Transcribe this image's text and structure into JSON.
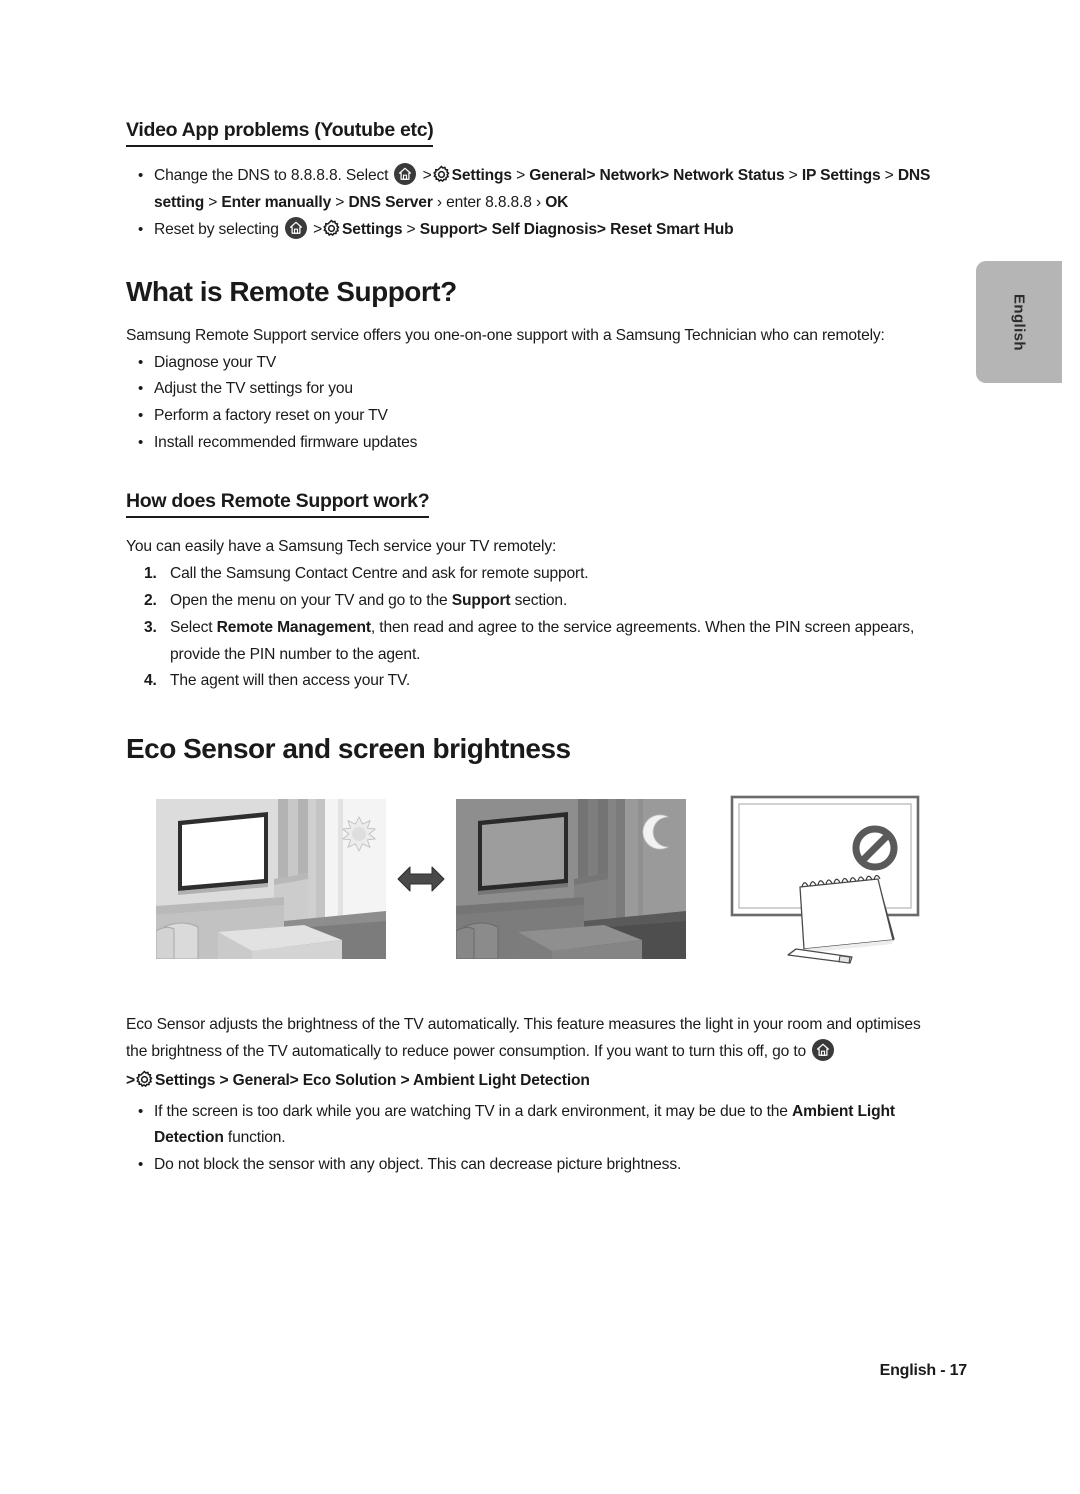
{
  "page": {
    "language_tab": "English",
    "footer": "English - 17"
  },
  "icons": {
    "home": "home-icon",
    "gear": "settings-gear-icon",
    "arrow": "double-arrow-icon",
    "prohibition": "prohibition-icon",
    "sun": "sun-icon",
    "moon": "moon-icon"
  },
  "sections": {
    "video_app": {
      "heading": "Video App problems (Youtube etc)",
      "bullets": [
        {
          "parts": [
            {
              "t": "Change the DNS to 8.8.8.8. Select ",
              "b": false
            },
            {
              "t": "HOME_ICON",
              "b": false
            },
            {
              "t": " >",
              "b": false
            },
            {
              "t": "GEAR_ICON",
              "b": false
            },
            {
              "t": "Settings",
              "b": true
            },
            {
              "t": " > ",
              "b": false
            },
            {
              "t": "General",
              "b": true
            },
            {
              "t": "> ",
              "b": true
            },
            {
              "t": "Network",
              "b": true
            },
            {
              "t": "> ",
              "b": true
            },
            {
              "t": "Network Status",
              "b": true
            },
            {
              "t": " > ",
              "b": false
            },
            {
              "t": "IP Settings",
              "b": true
            },
            {
              "t": " > ",
              "b": false
            },
            {
              "t": "DNS setting",
              "b": true
            },
            {
              "t": " > ",
              "b": false
            },
            {
              "t": "Enter manually",
              "b": true
            },
            {
              "t": " > ",
              "b": false
            },
            {
              "t": "DNS Server",
              "b": true
            },
            {
              "t": " › enter 8.8.8.8 › ",
              "b": false
            },
            {
              "t": "OK",
              "b": true
            }
          ]
        },
        {
          "parts": [
            {
              "t": "Reset by selecting ",
              "b": false
            },
            {
              "t": "HOME_ICON",
              "b": false
            },
            {
              "t": " >",
              "b": false
            },
            {
              "t": "GEAR_ICON",
              "b": false
            },
            {
              "t": "Settings",
              "b": true
            },
            {
              "t": " > ",
              "b": false
            },
            {
              "t": "Support",
              "b": true
            },
            {
              "t": "> ",
              "b": true
            },
            {
              "t": "Self Diagnosis",
              "b": true
            },
            {
              "t": "> ",
              "b": true
            },
            {
              "t": "Reset Smart Hub",
              "b": true
            }
          ]
        }
      ]
    },
    "remote_support": {
      "heading": "What is Remote Support?",
      "intro": "Samsung Remote Support service offers you one-on-one support with a Samsung Technician who can remotely:",
      "bullets": [
        "Diagnose your TV",
        "Adjust the TV settings for you",
        "Perform a factory reset on your TV",
        "Install recommended firmware updates"
      ]
    },
    "how_it_works": {
      "heading": "How does Remote Support work?",
      "intro": "You can easily have a Samsung Tech service your TV remotely:",
      "steps": [
        {
          "parts": [
            {
              "t": "Call the Samsung Contact Centre and ask for remote support.",
              "b": false
            }
          ]
        },
        {
          "parts": [
            {
              "t": "Open the menu on your TV and go to the ",
              "b": false
            },
            {
              "t": "Support",
              "b": true
            },
            {
              "t": " section.",
              "b": false
            }
          ]
        },
        {
          "parts": [
            {
              "t": "Select ",
              "b": false
            },
            {
              "t": "Remote Management",
              "b": true
            },
            {
              "t": ", then read and agree to the service agreements. When the PIN screen appears, provide the PIN number to the agent.",
              "b": false
            }
          ]
        },
        {
          "parts": [
            {
              "t": "The agent will then access your TV.",
              "b": false
            }
          ]
        }
      ]
    },
    "eco_sensor": {
      "heading": "Eco Sensor and screen brightness",
      "illustrations": [
        {
          "name": "bright-room-tv",
          "caption": "Bright living room with TV and sun outside window"
        },
        {
          "name": "dark-room-tv",
          "caption": "Dark living room with TV and moon outside window"
        },
        {
          "name": "blocked-sensor-tv",
          "caption": "TV with sensor blocked by a notebook and pen, prohibition sign"
        }
      ],
      "body": {
        "parts": [
          {
            "t": "Eco Sensor adjusts the brightness of the TV automatically. This feature measures the light in your room and optimises the brightness of the TV automatically to reduce power consumption. If you want to turn this off, go to ",
            "b": false
          },
          {
            "t": "HOME_ICON",
            "b": false
          }
        ]
      },
      "path": {
        "parts": [
          {
            "t": ">",
            "b": false
          },
          {
            "t": "GEAR_ICON",
            "b": false
          },
          {
            "t": "Settings",
            "b": true
          },
          {
            "t": " > ",
            "b": false
          },
          {
            "t": "General",
            "b": true
          },
          {
            "t": "> ",
            "b": true
          },
          {
            "t": "Eco Solution",
            "b": true
          },
          {
            "t": " > ",
            "b": false
          },
          {
            "t": "Ambient Light Detection",
            "b": true
          }
        ]
      },
      "bullets": [
        {
          "parts": [
            {
              "t": "If the screen is too dark while you are watching TV in a dark environment, it may be due to the ",
              "b": false
            },
            {
              "t": "Ambient Light Detection",
              "b": true
            },
            {
              "t": " function.",
              "b": false
            }
          ]
        },
        {
          "parts": [
            {
              "t": "Do not block the sensor with any object. This can decrease picture brightness.",
              "b": false
            }
          ]
        }
      ]
    }
  },
  "colors": {
    "text": "#1a1a1a",
    "tab_bg": "#b5b5b5",
    "icon_dark": "#3a3a3a",
    "arrow": "#4a4a4a"
  }
}
